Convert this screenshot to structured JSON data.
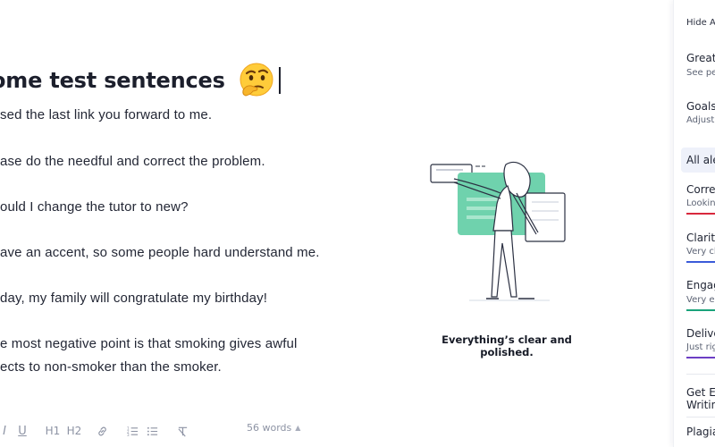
{
  "editor": {
    "title": "ome test sentences",
    "lines": [
      "sed the last link you forward to me.",
      "ase do the needful and correct the problem.",
      "ould I change the tutor to new?",
      "ave an accent, so some people hard understand me.",
      "day, my family will congratulate my birthday!",
      "e most negative point is that smoking gives awful",
      "ects to non-smoker than the smoker."
    ],
    "toolbar": {
      "italic": "I",
      "underline": "U",
      "h1": "H1",
      "h2": "H2",
      "word_count": "56 words"
    }
  },
  "illustration": {
    "caption": "Everything’s clear and polished."
  },
  "panel": {
    "hide_label": "Hide As",
    "goals_1_title": "Great",
    "goals_1_sub": "See pe",
    "goals_2_title": "Goals",
    "goals_2_sub": "Adjust",
    "all_alerts": "All ale",
    "categories": [
      {
        "title": "Corre",
        "sub": "Looking",
        "color": "#d8283d"
      },
      {
        "title": "Clarity",
        "sub": "Very cl",
        "color": "#3b5bd9"
      },
      {
        "title": "Engag",
        "sub": "Very en",
        "color": "#1aa37a"
      },
      {
        "title": "Delive",
        "sub": "Just rig",
        "color": "#6c3fc4"
      }
    ],
    "expert_1": "Get Ex",
    "expert_2": "Writing",
    "plagiarism": "Plagia"
  },
  "colors": {
    "accent_green": "#6fd2ad",
    "line_dark": "#2b3042"
  }
}
